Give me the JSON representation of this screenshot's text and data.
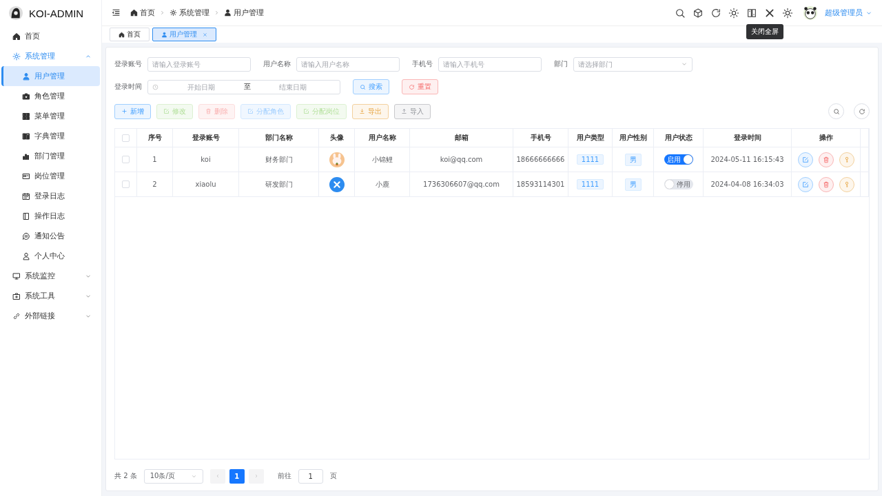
{
  "brand": {
    "title": "KOI-ADMIN"
  },
  "sidebar": {
    "items": [
      {
        "label": "首页",
        "selected": false
      },
      {
        "label": "系统管理",
        "expanded": true,
        "selected": true,
        "children": [
          {
            "label": "用户管理",
            "selected": true
          },
          {
            "label": "角色管理",
            "selected": false
          },
          {
            "label": "菜单管理",
            "selected": false
          },
          {
            "label": "字典管理",
            "selected": false
          },
          {
            "label": "部门管理",
            "selected": false
          },
          {
            "label": "岗位管理",
            "selected": false
          },
          {
            "label": "登录日志",
            "selected": false
          },
          {
            "label": "操作日志",
            "selected": false
          },
          {
            "label": "通知公告",
            "selected": false
          },
          {
            "label": "个人中心",
            "selected": false
          }
        ]
      },
      {
        "label": "系统监控",
        "expanded": false,
        "selected": false
      },
      {
        "label": "系统工具",
        "expanded": false,
        "selected": false
      },
      {
        "label": "外部链接",
        "expanded": false,
        "selected": false
      }
    ]
  },
  "breadcrumb": [
    "首页",
    "系统管理",
    "用户管理"
  ],
  "toolbar": {
    "tooltip": "关闭全屏",
    "user": "超级管理员"
  },
  "tabs": [
    {
      "label": "首页",
      "selected": false,
      "closable": false
    },
    {
      "label": "用户管理",
      "selected": true,
      "closable": true
    }
  ],
  "filters": [
    {
      "label": "登录账号",
      "placeholder": "请输入登录账号",
      "kind": "input"
    },
    {
      "label": "用户名称",
      "placeholder": "请输入用户名称",
      "kind": "input"
    },
    {
      "label": "手机号",
      "placeholder": "请输入手机号",
      "kind": "input"
    },
    {
      "label": "部门",
      "placeholder": "请选择部门",
      "kind": "select"
    }
  ],
  "date_filter": {
    "label": "登录时间",
    "start_placeholder": "开始日期",
    "separator": "至",
    "end_placeholder": "结束日期"
  },
  "search_buttons": [
    {
      "label": "搜索",
      "kind": "primary"
    },
    {
      "label": "重置",
      "kind": "danger"
    }
  ],
  "actions": [
    {
      "label": "新增",
      "kind": "primary",
      "disabled": false
    },
    {
      "label": "修改",
      "kind": "success",
      "disabled": true
    },
    {
      "label": "删除",
      "kind": "danger",
      "disabled": true
    },
    {
      "label": "分配角色",
      "kind": "primary",
      "disabled": true
    },
    {
      "label": "分配岗位",
      "kind": "success",
      "disabled": true
    },
    {
      "label": "导出",
      "kind": "warning",
      "disabled": false
    },
    {
      "label": "导入",
      "kind": "info",
      "disabled": false
    }
  ],
  "table": {
    "all_checked": false,
    "columns": [
      "序号",
      "登录账号",
      "部门名称",
      "头像",
      "用户名称",
      "邮箱",
      "手机号",
      "用户类型",
      "用户性别",
      "用户状态",
      "登录时间",
      "操作"
    ],
    "rows": [
      {
        "checked": false,
        "index": "1",
        "account": "koi",
        "dept": "财务部门",
        "avatar_loaded": true,
        "name": "小锦鲤",
        "email": "koi@qq.com",
        "phone": "18666666666",
        "type": "1111",
        "gender": "男",
        "status_on": true,
        "status": "启用",
        "login_time": "2024-05-11 16:15:43"
      },
      {
        "checked": false,
        "index": "2",
        "account": "xiaolu",
        "dept": "研发部门",
        "avatar_loaded": false,
        "name": "小鹿",
        "email": "1736306607@qq.com",
        "phone": "18593114301",
        "type": "1111",
        "gender": "男",
        "status_on": false,
        "status": "停用",
        "login_time": "2024-04-08 16:34:03"
      }
    ]
  },
  "pagination": {
    "total": "共 2 条",
    "page_size": "10条/页",
    "pages": [
      {
        "label": "1",
        "selected": true
      }
    ],
    "goto_label": "前往",
    "goto_value": "1",
    "goto_suffix": "页"
  }
}
